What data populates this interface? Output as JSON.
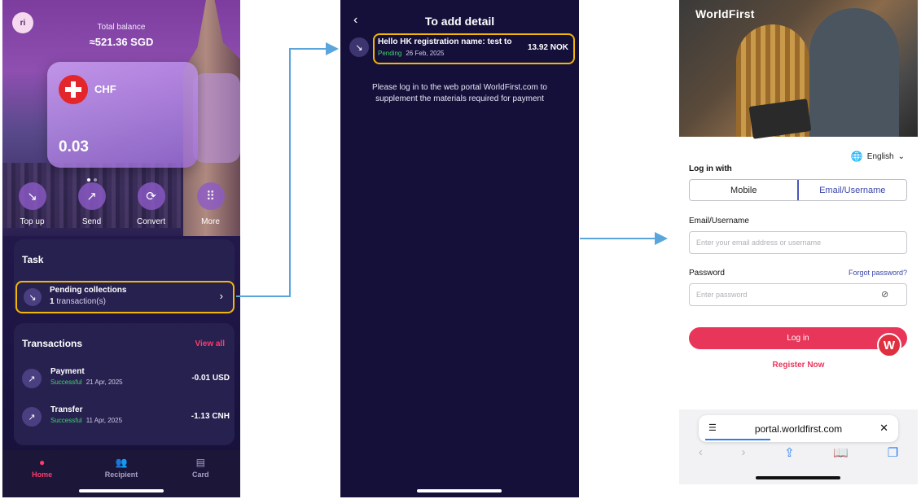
{
  "screen1": {
    "avatar_initials": "ri",
    "balance_label": "Total balance",
    "balance_value": "≈521.36 SGD",
    "card": {
      "currency": "CHF",
      "amount": "0.03"
    },
    "actions": [
      {
        "icon": "arrow-down-left-icon",
        "glyph": "↘",
        "label": "Top up"
      },
      {
        "icon": "arrow-up-right-icon",
        "glyph": "↗",
        "label": "Send"
      },
      {
        "icon": "convert-icon",
        "glyph": "⟳",
        "label": "Convert"
      },
      {
        "icon": "grid-icon",
        "glyph": "⠿",
        "label": "More"
      }
    ],
    "task": {
      "title": "Task",
      "item_title": "Pending collections",
      "item_count": "1",
      "item_suffix": " transaction(s)"
    },
    "transactions": {
      "title": "Transactions",
      "view_all": "View all",
      "rows": [
        {
          "name": "Payment",
          "status": "Successful",
          "date": "21 Apr, 2025",
          "amount": "-0.01 USD"
        },
        {
          "name": "Transfer",
          "status": "Successful",
          "date": "11 Apr, 2025",
          "amount": "-1.13 CNH"
        }
      ]
    },
    "nav": [
      {
        "label": "Home",
        "glyph": "●"
      },
      {
        "label": "Recipient",
        "glyph": "👥"
      },
      {
        "label": "Card",
        "glyph": "▤"
      }
    ]
  },
  "screen2": {
    "title": "To add detail",
    "detail": {
      "name": "Hello HK registration name: test to",
      "status": "Pending",
      "date": "26 Feb, 2025",
      "amount": "13.92 NOK"
    },
    "message": "Please log in to the web portal WorldFirst.com to supplement the materials required for payment"
  },
  "screen3": {
    "logo": "WorldFirst",
    "language": "English",
    "login_with": "Log in with",
    "tabs": [
      "Mobile",
      "Email/Username"
    ],
    "email_label": "Email/Username",
    "email_placeholder": "Enter your email address or username",
    "password_label": "Password",
    "forgot": "Forgot password?",
    "password_placeholder": "Enter password",
    "login_button": "Log in",
    "badge": "W",
    "register": "Register Now",
    "url": "portal.worldfirst.com"
  },
  "colors": {
    "highlight": "#f2b705",
    "arrow": "#5aa6dc",
    "accent_pink": "#e8365a",
    "link_blue": "#3a46a8"
  }
}
